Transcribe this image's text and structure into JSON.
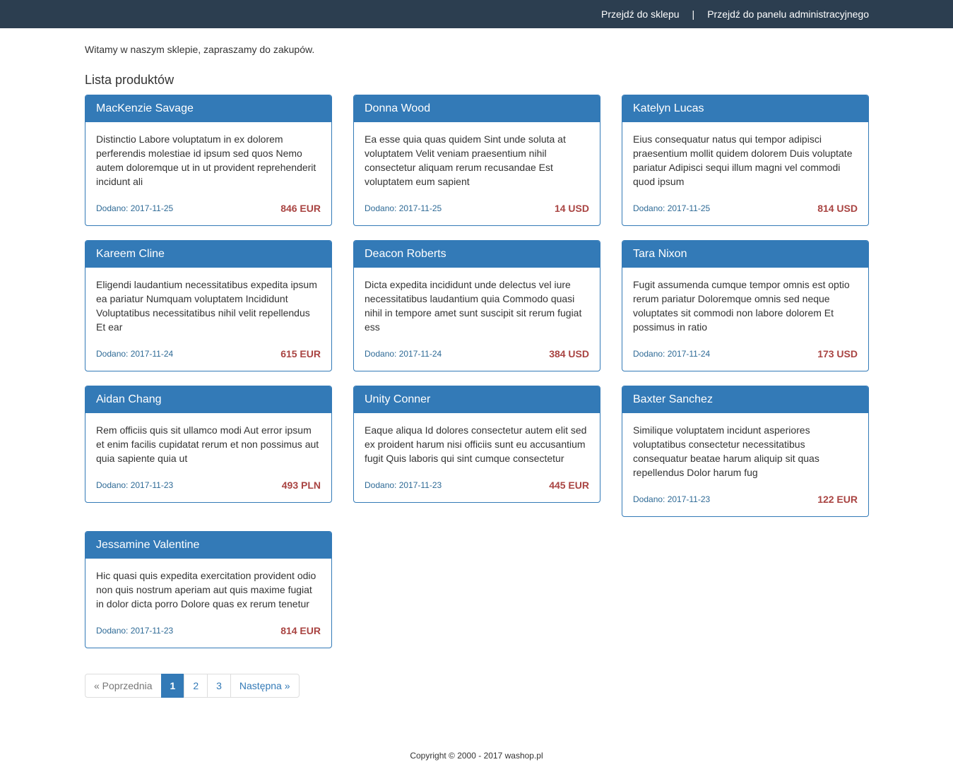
{
  "nav": {
    "shop_link": "Przejdź do sklepu",
    "separator": "|",
    "admin_link": "Przejdź do panelu administracyjnego"
  },
  "welcome": "Witamy w naszym sklepie, zapraszamy do zakupów.",
  "section_title": "Lista produktów",
  "products": [
    {
      "name": "MacKenzie Savage",
      "description": "Distinctio Labore voluptatum in ex dolorem perferendis molestiae id ipsum sed quos Nemo autem doloremque ut in ut provident reprehenderit incidunt ali",
      "date": "Dodano: 2017-11-25",
      "price": "846 EUR"
    },
    {
      "name": "Donna Wood",
      "description": "Ea esse quia quas quidem Sint unde soluta at voluptatem Velit veniam praesentium nihil consectetur aliquam rerum recusandae Est voluptatem eum sapient",
      "date": "Dodano: 2017-11-25",
      "price": "14 USD"
    },
    {
      "name": "Katelyn Lucas",
      "description": "Eius consequatur natus qui tempor adipisci praesentium mollit quidem dolorem Duis voluptate pariatur Adipisci sequi illum magni vel commodi quod ipsum",
      "date": "Dodano: 2017-11-25",
      "price": "814 USD"
    },
    {
      "name": "Kareem Cline",
      "description": "Eligendi laudantium necessitatibus expedita ipsum ea pariatur Numquam voluptatem Incididunt Voluptatibus necessitatibus nihil velit repellendus Et ear",
      "date": "Dodano: 2017-11-24",
      "price": "615 EUR"
    },
    {
      "name": "Deacon Roberts",
      "description": "Dicta expedita incididunt unde delectus vel iure necessitatibus laudantium quia Commodo quasi nihil in tempore amet sunt suscipit sit rerum fugiat ess",
      "date": "Dodano: 2017-11-24",
      "price": "384 USD"
    },
    {
      "name": "Tara Nixon",
      "description": "Fugit assumenda cumque tempor omnis est optio rerum pariatur Doloremque omnis sed neque voluptates sit commodi non labore dolorem Et possimus in ratio",
      "date": "Dodano: 2017-11-24",
      "price": "173 USD"
    },
    {
      "name": "Aidan Chang",
      "description": "Rem officiis quis sit ullamco modi Aut error ipsum et enim facilis cupidatat rerum et non possimus aut quia sapiente quia ut",
      "date": "Dodano: 2017-11-23",
      "price": "493 PLN"
    },
    {
      "name": "Unity Conner",
      "description": "Eaque aliqua Id dolores consectetur autem elit sed ex proident harum nisi officiis sunt eu accusantium fugit Quis laboris qui sint cumque consectetur",
      "date": "Dodano: 2017-11-23",
      "price": "445 EUR"
    },
    {
      "name": "Baxter Sanchez",
      "description": "Similique voluptatem incidunt asperiores voluptatibus consectetur necessitatibus consequatur beatae harum aliquip sit quas repellendus Dolor harum fug",
      "date": "Dodano: 2017-11-23",
      "price": "122 EUR"
    },
    {
      "name": "Jessamine Valentine",
      "description": "Hic quasi quis expedita exercitation provident odio non quis nostrum aperiam aut quis maxime fugiat in dolor dicta porro Dolore quas ex rerum tenetur",
      "date": "Dodano: 2017-11-23",
      "price": "814 EUR"
    }
  ],
  "pagination": {
    "prev": "« Poprzednia",
    "pages": [
      "1",
      "2",
      "3"
    ],
    "active": "1",
    "next": "Następna »"
  },
  "footer": "Copyright © 2000 - 2017 washop.pl",
  "colors": {
    "topbar": "#2c3e50",
    "primary": "#337ab7",
    "price": "#a94442"
  }
}
